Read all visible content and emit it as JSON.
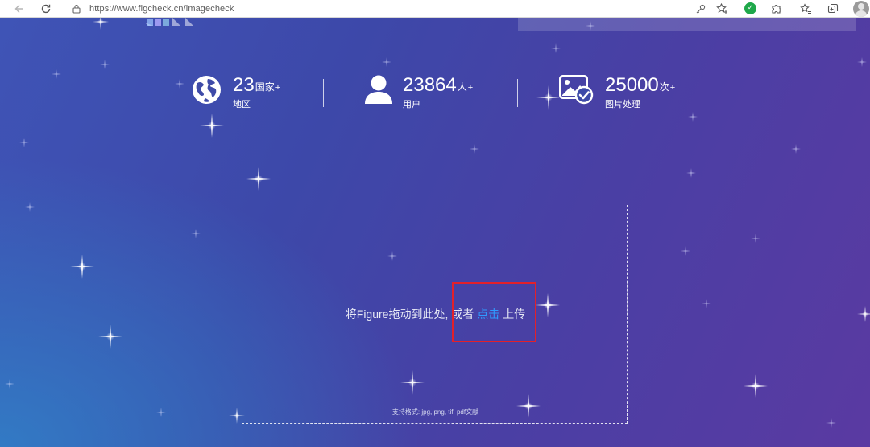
{
  "browser": {
    "url": "https://www.figcheck.cn/imagecheck",
    "icons": {
      "back": "arrow-left-icon",
      "refresh": "refresh-icon",
      "lock": "lock-icon",
      "key": "key-icon",
      "favorite": "star-add-icon",
      "extension_green": "shield-check-icon",
      "extensions": "puzzle-icon",
      "favorites_list": "favorites-icon",
      "collections": "collections-icon",
      "profile": "avatar-icon"
    },
    "extension_glyph": "✓"
  },
  "stats": [
    {
      "icon": "globe-icon",
      "number": "23",
      "unit": "国家",
      "plus": "+",
      "label": "地区"
    },
    {
      "icon": "user-icon",
      "number": "23864",
      "unit": "人",
      "plus": "+",
      "label": "用户"
    },
    {
      "icon": "image-check-icon",
      "number": "25000",
      "unit": "次",
      "plus": "+",
      "label": "图片处理"
    }
  ],
  "upload": {
    "prompt_before": "将Figure拖动到此处, 或者",
    "link_text": "点击",
    "prompt_after": "上传",
    "formats": "支持格式: jpg, png, tif, pdf文献"
  },
  "colors": {
    "link": "#2f9bff",
    "highlight": "#e3202a",
    "extension_green": "#1fa84a"
  }
}
